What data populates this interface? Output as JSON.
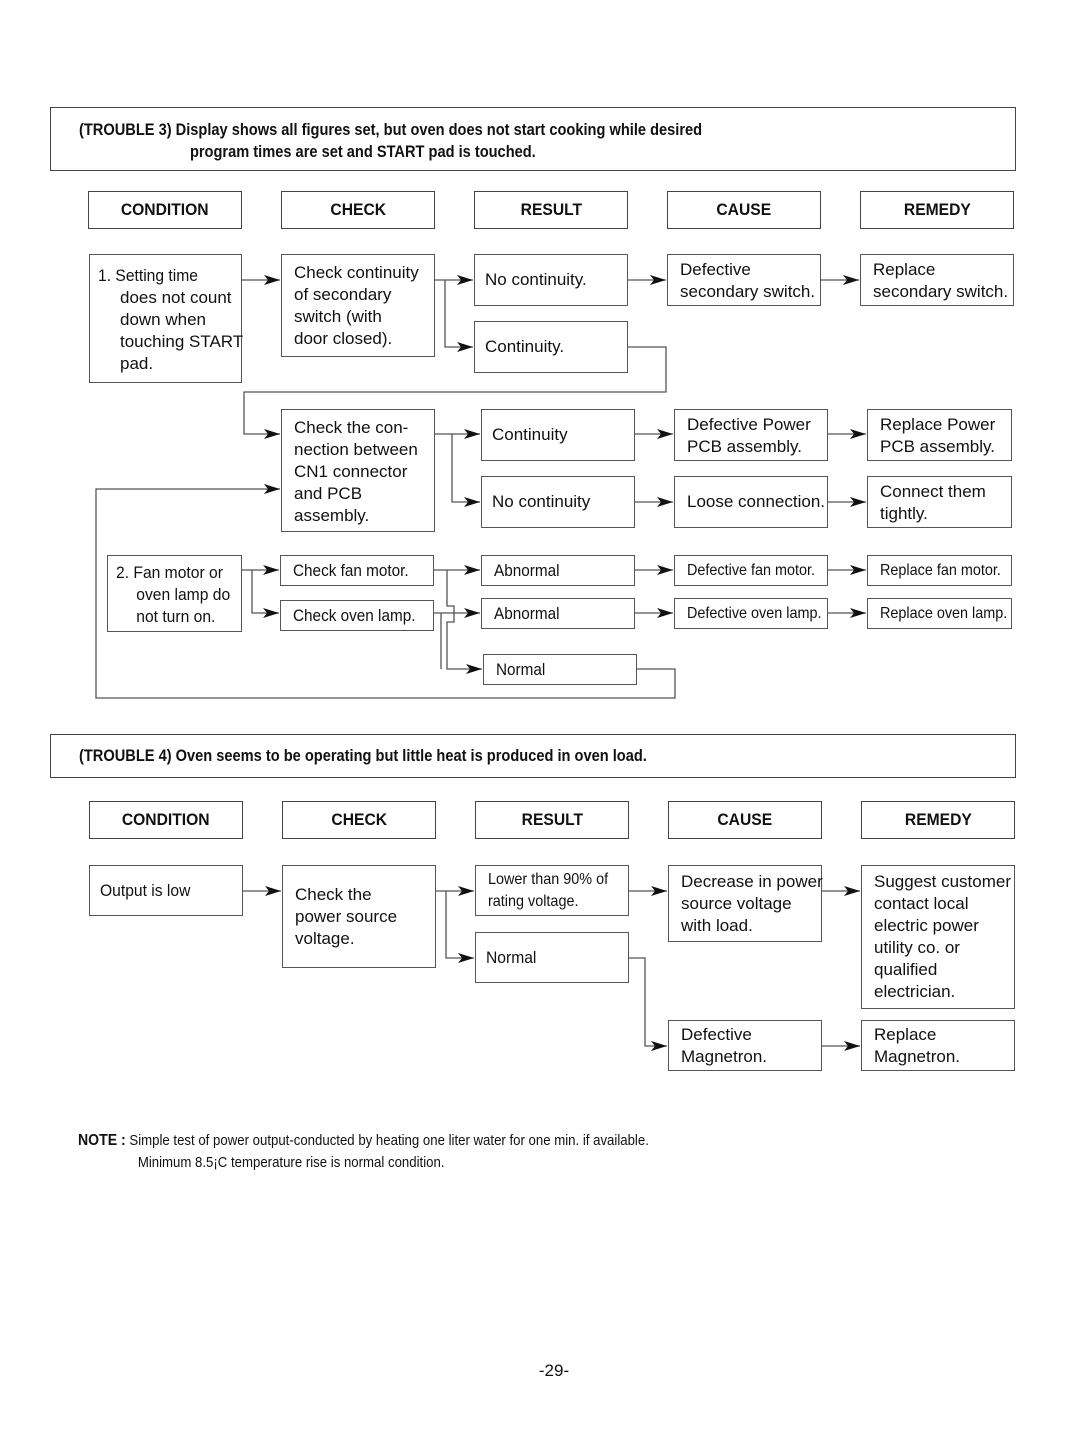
{
  "trouble3": {
    "line1": "(TROUBLE 3) Display shows all figures set, but oven does not start cooking while desired",
    "line2": "program times are set and START pad is touched."
  },
  "trouble4": {
    "title": "(TROUBLE 4) Oven seems to be operating but little heat is produced in oven load."
  },
  "headers": [
    "CONDITION",
    "CHECK",
    "RESULT",
    "CAUSE",
    "REMEDY"
  ],
  "t3": {
    "cond1": {
      "line1": "1. Setting time",
      "lines": [
        "does not count",
        "down when",
        "touching START",
        "pad."
      ]
    },
    "check1": [
      "Check continuity",
      "of secondary",
      "switch (with",
      "door closed)."
    ],
    "result_no_continuity": "No continuity.",
    "result_continuity": "Continuity.",
    "cause_secondary": [
      "Defective",
      "secondary switch."
    ],
    "remedy_secondary": [
      "Replace",
      "secondary switch."
    ],
    "check2": [
      "Check the con-",
      "nection between",
      "CN1 connector",
      "and PCB",
      "assembly."
    ],
    "result2_continuity": "Continuity",
    "result2_no_continuity": "No continuity",
    "cause_power_pcb": [
      "Defective Power",
      "PCB assembly."
    ],
    "remedy_power_pcb": [
      "Replace Power",
      "PCB assembly."
    ],
    "cause_loose": "Loose  connection.",
    "remedy_loose": [
      "Connect them",
      "tightly."
    ],
    "cond2": {
      "line1": "2. Fan motor or",
      "lines": [
        "oven lamp do",
        "not turn on."
      ]
    },
    "check_fan": "Check fan motor.",
    "check_lamp": "Check oven lamp.",
    "result_fan_abnormal": "Abnormal",
    "result_lamp_abnormal": "Abnormal",
    "result_normal": "Normal",
    "cause_fan": "Defective fan motor.",
    "cause_lamp": "Defective oven lamp.",
    "remedy_fan": "Replace fan motor.",
    "remedy_lamp": "Replace oven lamp."
  },
  "t4": {
    "cond": "Output is low",
    "check": [
      "Check the",
      "power source",
      "voltage."
    ],
    "result_low": [
      "Lower than 90% of",
      "rating voltage."
    ],
    "result_normal": "Normal",
    "cause_decrease": [
      "Decrease in power",
      "source voltage",
      "with load."
    ],
    "remedy_suggest": [
      "Suggest customer",
      "contact local",
      "electric power",
      "utility co. or",
      "qualified",
      "electrician."
    ],
    "cause_magnetron": [
      "Defective",
      "Magnetron."
    ],
    "remedy_magnetron": [
      "Replace",
      "Magnetron."
    ]
  },
  "note": {
    "label": "NOTE :",
    "line1": "Simple test of power output-conducted by heating one liter water for one min. if available.",
    "line2": "Minimum 8.5¡C temperature rise is normal condition."
  },
  "page_number": "-29-"
}
